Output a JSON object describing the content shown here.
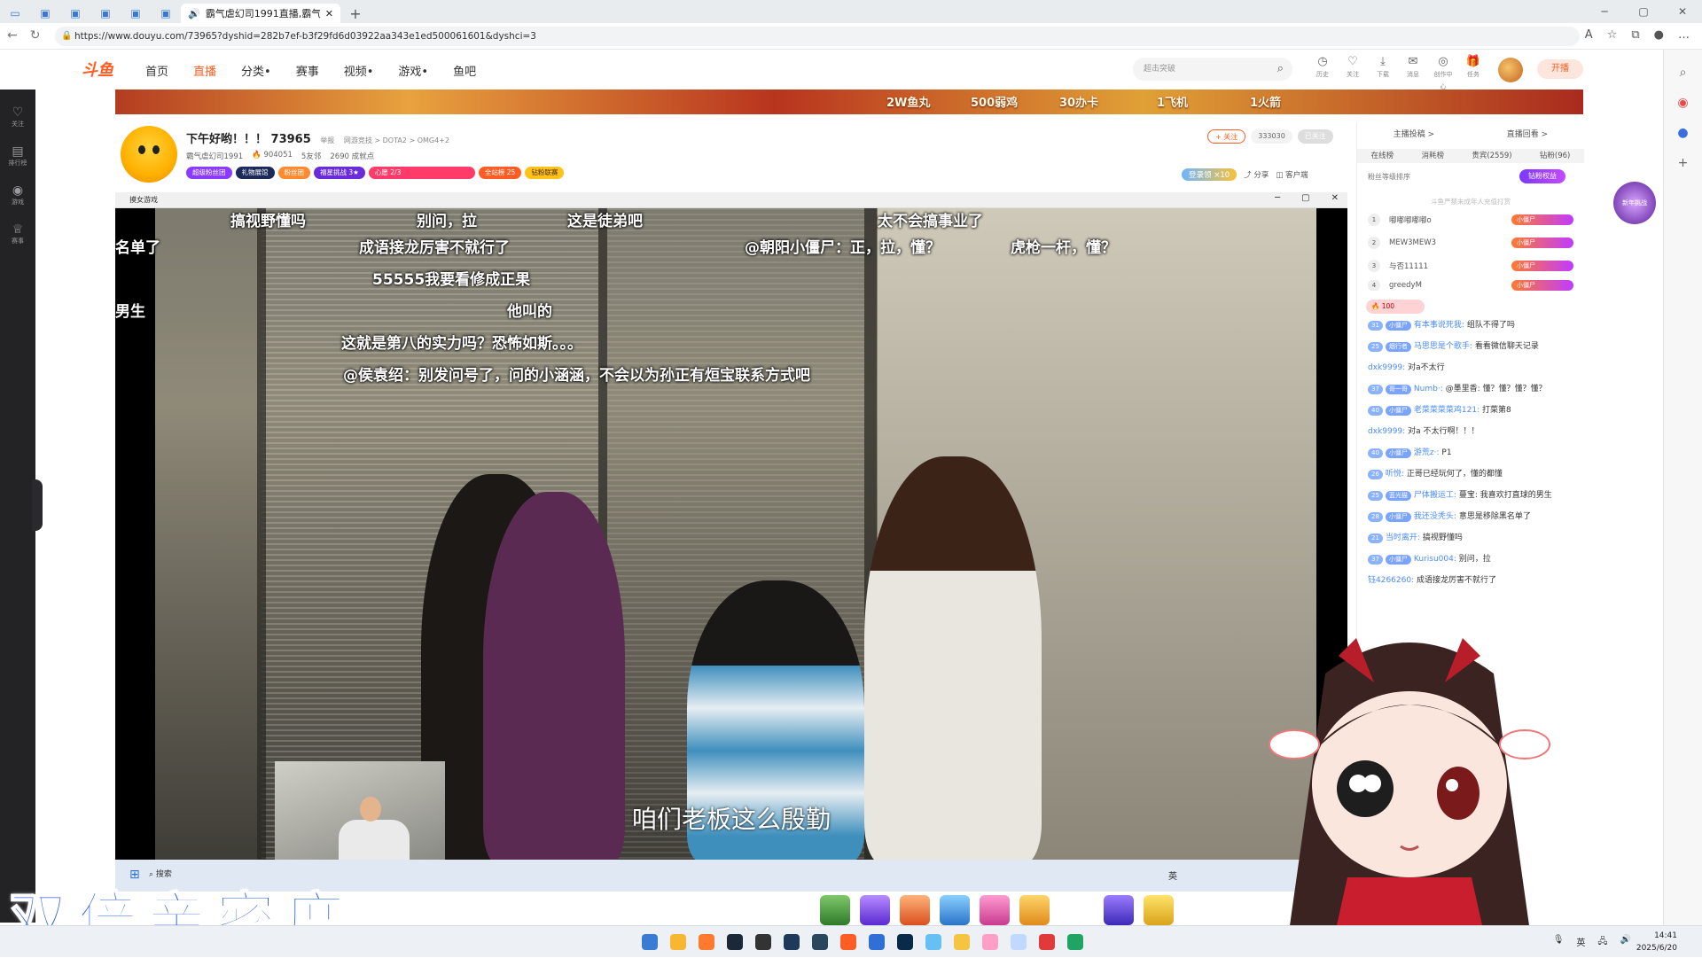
{
  "browser": {
    "active_tab_title": "霸气虐幻司1991直播,霸气虐",
    "url": "https://www.douyu.com/73965?dyshid=282b7ef-b3f29fd6d03922aa343e1ed500061601&dyshci=3"
  },
  "site": {
    "logo": "斗鱼",
    "menu": [
      "首页",
      "直播",
      "分类•",
      "赛事",
      "视频•",
      "游戏•",
      "鱼吧"
    ],
    "search_placeholder": "超击突破",
    "header_icons": [
      "历史",
      "关注",
      "下载",
      "消息",
      "创作中心",
      "任务"
    ],
    "kaibo": "开播",
    "left_sidebar": [
      "关注",
      "排行榜",
      "游戏",
      "赛事"
    ]
  },
  "banner": {
    "labels": [
      "2W鱼丸",
      "500弱鸡",
      "30办卡",
      "1飞机",
      "1火箭"
    ]
  },
  "room": {
    "title": "下午好哟！！！ 73965",
    "report": "举报",
    "category": "网游竞技 > DOTA2 > OMG4+2",
    "anchor_name": "霸气虐幻司1991",
    "heat": "904051",
    "friends": "5友邻",
    "achievements": "2690 成就点",
    "badges": [
      "超级粉丝团",
      "礼物展馆",
      "粉丝团",
      "福星挑战 3★",
      "心愿 2/3",
      "全站榜 25",
      "钻粉联赛"
    ],
    "follow_btn": "+ 关注",
    "follow_count": "333030",
    "followed_label": "已关注",
    "login_reward": "登录领 ×10",
    "share": "分享",
    "client": "客户端"
  },
  "player": {
    "title": "摸女游戏",
    "subtitle": "咱们老板这么殷勤",
    "danmu": [
      "搞视野懂吗",
      "别问，拉",
      "这是徒弟吧",
      "太不会搞事业了",
      "名单了",
      "成语接龙厉害不就行了",
      "@朝阳小僵尸：正，拉，懂？",
      "虎枪一杆，懂？",
      "55555我要看修成正果",
      "男生",
      "他叫的",
      "这就是第八的实力吗？恐怖如斯。。。",
      "@侯袁绍：别发问号了，问的小涵涵，不会以为孙正有烜宝联系方式吧"
    ],
    "taskbar_search": "搜索"
  },
  "overlay_text": "双倍亲密度",
  "right_panel": {
    "tabs1": [
      "主播投稿 >",
      "直播回看 >"
    ],
    "tabs2": [
      "在线榜",
      "消耗榜",
      "贵宾(2559)",
      "钻粉(96)"
    ],
    "rank_head": "粉丝等级排序",
    "rank_btn": "钻粉权益",
    "rank_note": "斗鱼严禁未成年人充值打赏",
    "ranks": [
      {
        "n": "1",
        "name": "嘟嘟嘟嘟嘟o"
      },
      {
        "n": "2",
        "name": "MEW3MEW3"
      },
      {
        "n": "3",
        "name": "与否11111"
      },
      {
        "n": "4",
        "name": "greedyM"
      }
    ],
    "hot": "100",
    "chat": [
      {
        "lv": "31",
        "fan": "小僵尸",
        "u": "有本事说死我:",
        "t": "组队不得了吗"
      },
      {
        "lv": "25",
        "fan": "烟行者",
        "u": "马思思是个歌手:",
        "t": "看看微信聊天记录"
      },
      {
        "lv": "",
        "fan": "",
        "u": "dxk9999:",
        "t": "对a不太行"
      },
      {
        "lv": "37",
        "fan": "哥一哥",
        "u": "Numb·:",
        "t": "@墨里香: 懂？懂？懂？懂？"
      },
      {
        "lv": "40",
        "fan": "小僵尸",
        "u": "老菜菜菜菜鸡121:",
        "t": "打菜第8"
      },
      {
        "lv": "",
        "fan": "",
        "u": "dxk9999:",
        "t": "对a 不太行啊！！！"
      },
      {
        "lv": "40",
        "fan": "小僵尸",
        "u": "游荒z·:",
        "t": "P1"
      },
      {
        "lv": "26",
        "fan": "",
        "u": "听悦:",
        "t": "正哥已经玩何了，懂的都懂"
      },
      {
        "lv": "25",
        "fan": "蓝光猫",
        "u": "尸体搬运工:",
        "t": "蔓宝: 我喜欢打直球的男生"
      },
      {
        "lv": "28",
        "fan": "小僵尸",
        "u": "我还没秃头:",
        "t": "意思是移除黑名单了"
      },
      {
        "lv": "21",
        "fan": "",
        "u": "当时离开:",
        "t": "搞视野懂吗"
      },
      {
        "lv": "37",
        "fan": "小僵尸",
        "u": "Kurisu004:",
        "t": "别问，拉"
      },
      {
        "lv": "",
        "fan": "",
        "u": "钰4266260:",
        "t": "成语接龙厉害不就行了"
      }
    ],
    "act_badge": "新年挑战"
  },
  "os": {
    "time": "14:41",
    "date": "2025/6/20",
    "ime": "英"
  }
}
